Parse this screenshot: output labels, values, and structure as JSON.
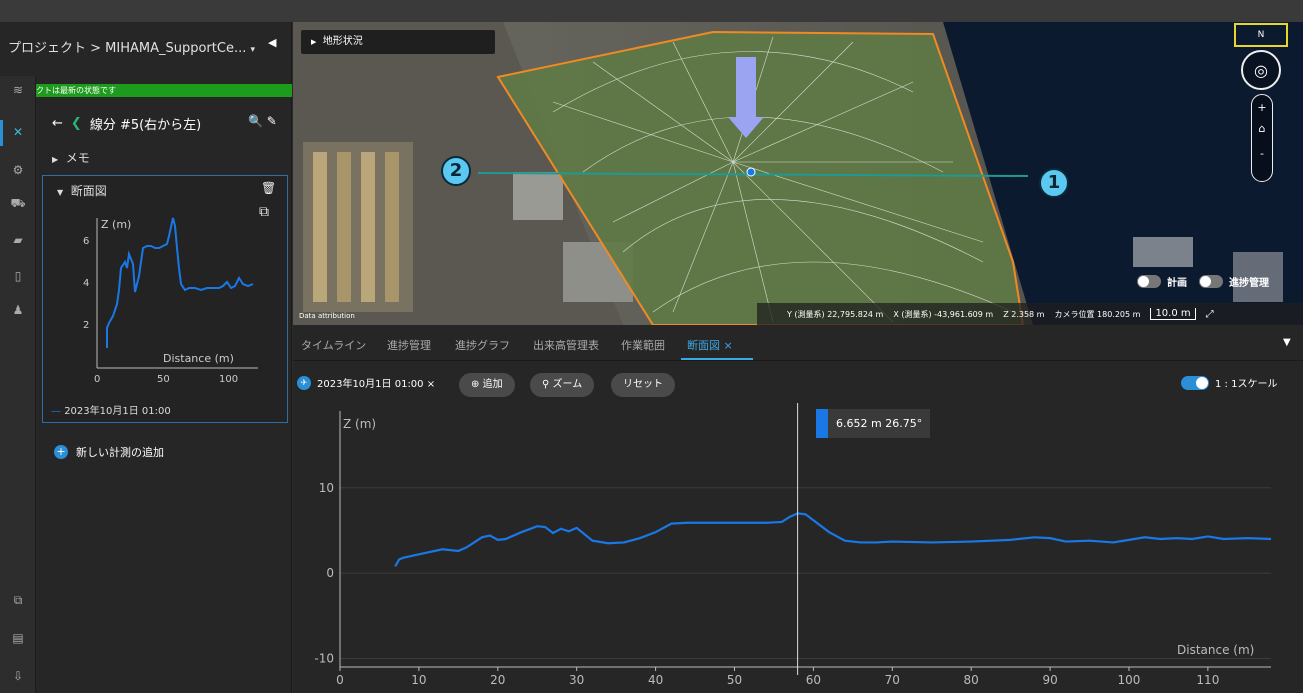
{
  "project": {
    "breadcrumb": "プロジェクト > MIHAMA_SupportCe...",
    "dropdown_icon": "caret-down-icon",
    "collapse_icon": "collapse-left-icon",
    "status": "プロジェクトは最新の状態です"
  },
  "segment": {
    "title": "線分 #5(右から左)",
    "back_icon": "arrow-left-icon",
    "search_icon": "search-icon",
    "edit_icon": "pencil-icon"
  },
  "memo": {
    "label": "メモ"
  },
  "section_card": {
    "title": "断面図",
    "legend": "2023年10月1日 01:00",
    "mini_ylabel": "Z (m)",
    "mini_xlabel": "Distance (m)",
    "mini_yticks": [
      "6",
      "4",
      "2"
    ],
    "mini_xticks": [
      "0",
      "50",
      "100"
    ]
  },
  "add_measurement": "新しい計測の追加",
  "map": {
    "terrain_label": "地形状況",
    "compass_label": "N",
    "zoom_in": "+",
    "zoom_out": "-",
    "toggle_plan": "計画",
    "toggle_progress": "進捗管理",
    "attribution": "Data attribution",
    "coord_y": "Y (測量系) 22,795.824 m",
    "coord_x": "X (測量系) -43,961.609 m",
    "coord_z": "Z 2.358 m",
    "camera": "カメラ位置 180.205 m",
    "scale": "10.0 m",
    "badge1": "1",
    "badge2": "2"
  },
  "tabs": {
    "items": [
      "タイムライン",
      "進捗管理",
      "進捗グラフ",
      "出来高管理表",
      "作業範囲",
      "断面図 ×"
    ],
    "active_index": 5
  },
  "toolbar": {
    "date": "2023年10月1日 01:00 ×",
    "add": "追加",
    "zoom": "ズーム",
    "reset": "リセット",
    "scale_toggle": "1 : 1スケール"
  },
  "tooltip": {
    "value": "6.652 m  26.75°"
  },
  "chart_data": {
    "type": "line",
    "ylabel": "Z (m)",
    "xlabel": "Distance (m)",
    "xlim": [
      0,
      118
    ],
    "ylim": [
      -11,
      19
    ],
    "xticks": [
      0,
      10,
      20,
      30,
      40,
      50,
      60,
      70,
      80,
      90,
      100,
      110
    ],
    "yticks": [
      -10,
      0,
      10
    ],
    "series": [
      {
        "name": "2023年10月1日 01:00",
        "color": "#1a78e6",
        "x": [
          7,
          7.5,
          8,
          10,
          13,
          15,
          16,
          18,
          19,
          20,
          21,
          23,
          25,
          26,
          27,
          28,
          29,
          30,
          32,
          34,
          36,
          38,
          40,
          42,
          44,
          46,
          48,
          50,
          52,
          54,
          56,
          57,
          58,
          59,
          60,
          62,
          64,
          66,
          68,
          70,
          75,
          80,
          85,
          88,
          90,
          92,
          95,
          98,
          100,
          102,
          104,
          106,
          108,
          110,
          112,
          115,
          118
        ],
        "y": [
          0.8,
          1.6,
          1.8,
          2.2,
          2.8,
          2.6,
          3.0,
          4.2,
          4.4,
          3.9,
          4.0,
          4.8,
          5.5,
          5.4,
          4.7,
          5.2,
          4.9,
          5.3,
          3.8,
          3.5,
          3.6,
          4.1,
          4.8,
          5.8,
          5.9,
          5.9,
          5.9,
          5.9,
          5.9,
          5.9,
          6.0,
          6.6,
          7.0,
          6.9,
          6.2,
          4.8,
          3.8,
          3.6,
          3.6,
          3.7,
          3.6,
          3.7,
          3.9,
          4.2,
          4.1,
          3.7,
          3.8,
          3.6,
          3.9,
          4.2,
          4.0,
          4.1,
          4.0,
          4.3,
          4.0,
          4.1,
          4.0
        ]
      }
    ],
    "cursor_x": 58
  }
}
